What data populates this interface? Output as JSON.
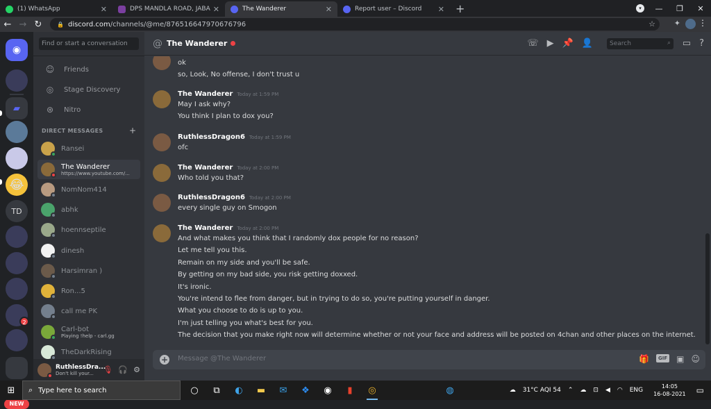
{
  "browser": {
    "tabs": [
      {
        "title": "(1) WhatsApp",
        "color": "#25d366",
        "active": false
      },
      {
        "title": "DPS MANDLA ROAD, JABALPUR",
        "color": "#7b3fa0",
        "active": false
      },
      {
        "title": "The Wanderer",
        "color": "#5865f2",
        "active": true
      },
      {
        "title": "Report user – Discord",
        "color": "#5865f2",
        "active": false
      }
    ],
    "url_host": "discord.com",
    "url_path": "/channels/@me/876516647970676796"
  },
  "dm_column": {
    "search_placeholder": "Find or start a conversation",
    "nav": [
      {
        "label": "Friends",
        "icon": "friends-icon"
      },
      {
        "label": "Stage Discovery",
        "icon": "stage-icon"
      },
      {
        "label": "Nitro",
        "icon": "nitro-icon"
      }
    ],
    "header": "DIRECT MESSAGES",
    "items": [
      {
        "name": "Ransei",
        "sub": "",
        "avatar": "#c9a24a",
        "status": "#3ba55d",
        "active": false
      },
      {
        "name": "The Wanderer",
        "sub": "https://www.youtube.com/...",
        "avatar": "#8a6a3a",
        "status": "#ed4245",
        "active": true
      },
      {
        "name": "NomNom414",
        "sub": "",
        "avatar": "#b89a80",
        "status": "#747f8d",
        "active": false
      },
      {
        "name": "abhk",
        "sub": "",
        "avatar": "#4aa36b",
        "status": "#747f8d",
        "active": false
      },
      {
        "name": "hoennseptile",
        "sub": "",
        "avatar": "#9aa88a",
        "status": "#747f8d",
        "active": false
      },
      {
        "name": "dinesh",
        "sub": "",
        "avatar": "#f2f2f2",
        "status": "#747f8d",
        "active": false
      },
      {
        "name": "Harsimran )",
        "sub": "",
        "avatar": "#6b5a4a",
        "status": "#747f8d",
        "active": false
      },
      {
        "name": "Ron...5",
        "sub": "",
        "avatar": "#e0b23a",
        "status": "#747f8d",
        "active": false
      },
      {
        "name": "call me PK",
        "sub": "",
        "avatar": "#747f8d",
        "status": "#747f8d",
        "active": false
      },
      {
        "name": "Carl-bot",
        "sub": "Playing !help - carl.gg",
        "avatar": "#7aa83a",
        "status": "#3ba55d",
        "active": false
      },
      {
        "name": "TheDarkRising",
        "sub": "",
        "avatar": "#d8e8d8",
        "status": "#747f8d",
        "active": false
      }
    ]
  },
  "guilds": {
    "td_label": "TD",
    "new_label": "NEW",
    "badge_count": "2"
  },
  "user_panel": {
    "name": "RuthlessDra...",
    "status": "Don't kill your..."
  },
  "channel": {
    "title": "The Wanderer",
    "search_placeholder": "Search"
  },
  "messages": [
    {
      "author": "",
      "time": "",
      "avatar": "#7a5a43",
      "lines": [
        "ok",
        "so, Look, No offense, I don't trust u"
      ]
    },
    {
      "author": "The Wanderer",
      "time": "Today at 1:59 PM",
      "avatar": "#8a6a3a",
      "lines": [
        "May I ask why?",
        "You think I plan to dox you?"
      ]
    },
    {
      "author": "RuthlessDragon6",
      "time": "Today at 1:59 PM",
      "avatar": "#7a5a43",
      "lines": [
        "ofc"
      ]
    },
    {
      "author": "The Wanderer",
      "time": "Today at 2:00 PM",
      "avatar": "#8a6a3a",
      "lines": [
        "Who told you that?"
      ]
    },
    {
      "author": "RuthlessDragon6",
      "time": "Today at 2:00 PM",
      "avatar": "#7a5a43",
      "lines": [
        "every single guy on Smogon"
      ]
    },
    {
      "author": "The Wanderer",
      "time": "Today at 2:00 PM",
      "avatar": "#8a6a3a",
      "lines": [
        "And what makes you think that I randomly dox people for no reason?",
        "Let me tell you this.",
        "Remain on my side and you'll be safe.",
        "By getting on my bad side, you risk getting doxxed.",
        "It's ironic.",
        "You're intend to flee from danger, but in trying to do so, you're putting yourself in danger.",
        "What you choose to do is up to you.",
        "I'm just telling you what's best for you.",
        "The decision that you make right now will determine whether or not your face and address will be posted on 4chan and other places on the internet."
      ]
    }
  ],
  "composer": {
    "placeholder": "Message @The Wanderer",
    "gif_label": "GIF"
  },
  "taskbar": {
    "search_placeholder": "Type here to search",
    "weather": "31°C  AQI 54",
    "lang": "ENG",
    "time": "14:05",
    "date": "16-08-2021"
  }
}
